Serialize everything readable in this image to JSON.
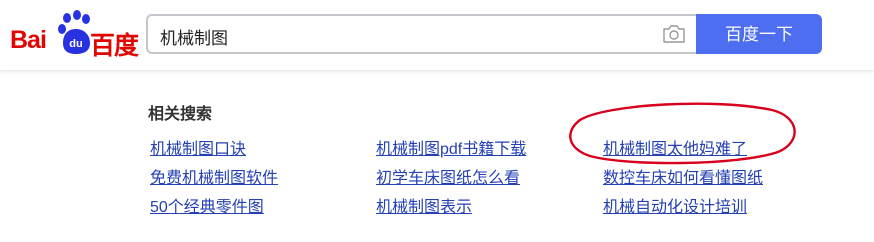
{
  "logo": {
    "text_left": "Bai",
    "text_right": "百度",
    "paw_text": "du"
  },
  "search": {
    "value": "机械制图",
    "button_label": "百度一下"
  },
  "related": {
    "title": "相关搜索",
    "links": [
      [
        "机械制图口诀",
        "机械制图pdf书籍下载",
        "机械制图太他妈难了"
      ],
      [
        "免费机械制图软件",
        "初学车床图纸怎么看",
        "数控车床如何看懂图纸"
      ],
      [
        "50个经典零件图",
        "机械制图表示",
        "机械自动化设计培训"
      ]
    ]
  },
  "colors": {
    "brand_red": "#e10601",
    "button_blue": "#4e6ef2",
    "link_blue": "#2440b3",
    "annotation_red": "#d8001c"
  },
  "icons": {
    "camera": "camera-icon",
    "paw": "paw-icon"
  }
}
